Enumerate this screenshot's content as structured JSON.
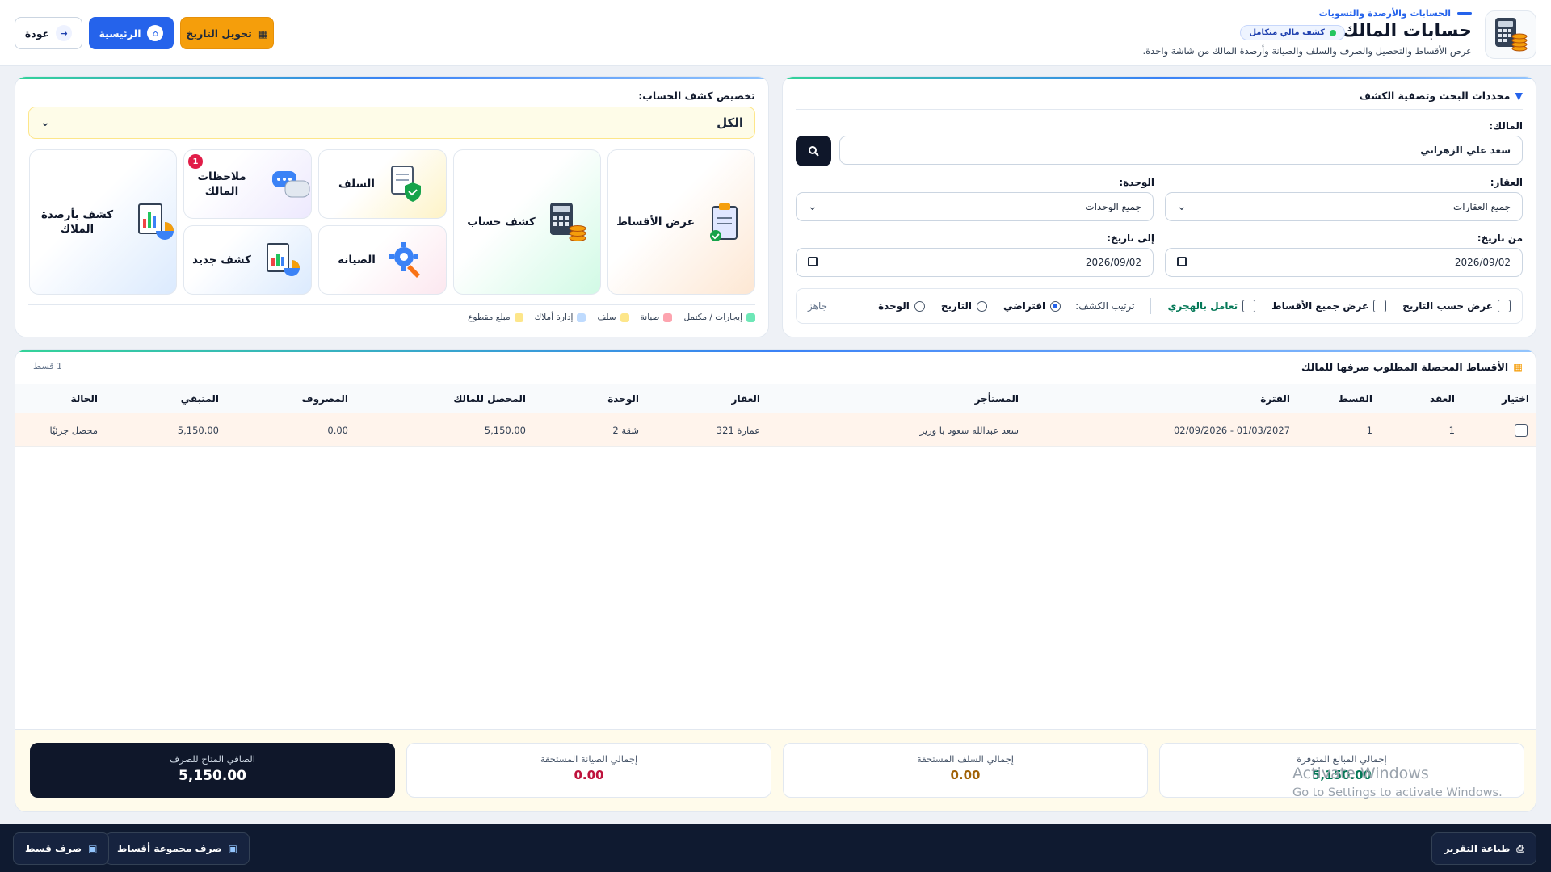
{
  "header": {
    "breadcrumb": "الحسابات والأرصدة والتسويات",
    "title": "حسابات المالك",
    "badge": "كشف مالي متكامل",
    "subtitle": "عرض الأقساط والتحصيل والصرف والسلف والصيانة وأرصدة المالك من شاشة واحدة.",
    "convert_date_label": "تحويل التاريخ",
    "home_label": "الرئيسية",
    "back_label": "عودة"
  },
  "filters": {
    "title": "محددات البحث وتصفية الكشف",
    "owner_label": "المالك:",
    "owner_value": "سعد علي الزهراني",
    "property_label": "العقار:",
    "property_value": "جميع العقارات",
    "unit_label": "الوحدة:",
    "unit_value": "جميع الوحدات",
    "from_label": "من تاريخ:",
    "from_value": "2026/09/02",
    "to_label": "إلى تاريخ:",
    "to_value": "2026/09/02",
    "opt_by_date": "عرض حسب التاريخ",
    "opt_all_installments": "عرض جميع الأقساط",
    "opt_hijri": "تعامل بالهجري",
    "sort_label": "ترتيب الكشف:",
    "sort_default": "افتراضي",
    "sort_date": "التاريخ",
    "sort_unit": "الوحدة",
    "status": "جاهز"
  },
  "custom": {
    "title": "تخصيص كشف الحساب:",
    "select_value": "الكل",
    "cards": {
      "installments": "عرض الأقساط",
      "statement": "كشف حساب",
      "advances": "السلف",
      "notes": "ملاحظات المالك",
      "notes_count": "1",
      "balances": "كشف بأرصدة الملاك",
      "maintenance": "الصيانة",
      "new_statement": "كشف جديد"
    },
    "legend": [
      "إيجارات / مكتمل",
      "صيانة",
      "سلف",
      "إدارة أملاك",
      "مبلغ مقطوع"
    ],
    "legend_colors": [
      "#6ee7b7",
      "#fda4af",
      "#fde68a",
      "#bfdbfe",
      "#fde68a"
    ]
  },
  "table": {
    "title": "الأقساط المحصلة المطلوب صرفها للمالك",
    "count": "1 قسط",
    "headers": [
      "اختيار",
      "العقد",
      "القسط",
      "الفترة",
      "المستأجر",
      "العقار",
      "الوحدة",
      "المحصل للمالك",
      "المصروف",
      "المتبقي",
      "الحالة"
    ],
    "rows": [
      [
        "",
        "1",
        "1",
        "01/03/2027 - 02/09/2026",
        "سعد عبدالله سعود با وزير",
        "عمارة 321",
        "شقة 2",
        "5,150.00",
        "0.00",
        "5,150.00",
        "محصل جزئيًا"
      ]
    ]
  },
  "summary": {
    "available_label": "إجمالي المبالغ المتوفرة",
    "available_value": "5,150.00",
    "advances_label": "إجمالي السلف المستحقة",
    "advances_value": "0.00",
    "maintenance_label": "إجمالي الصيانة المستحقة",
    "maintenance_value": "0.00",
    "net_label": "الصافي المتاح للصرف",
    "net_value": "5,150.00"
  },
  "footer": {
    "print_label": "طباعة التقرير",
    "group_pay_label": "صرف مجموعة أقساط",
    "pay_label": "صرف قسط"
  },
  "watermark": {
    "line1": "Activate Windows",
    "line2": "Go to Settings to activate Windows."
  },
  "colors": {
    "accent": "#2563eb",
    "dark": "#0f172a",
    "orange": "#f59e0b",
    "green": "#047857",
    "brown": "#a16207",
    "red": "#be123c"
  }
}
